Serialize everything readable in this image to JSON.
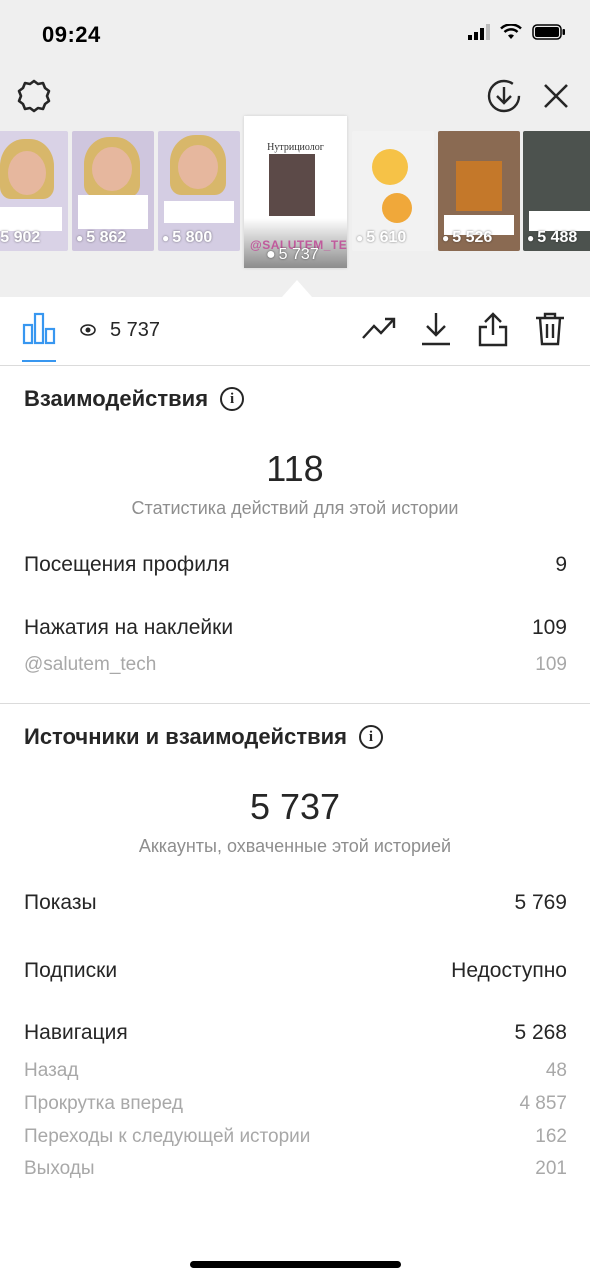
{
  "status_bar": {
    "time": "09:24"
  },
  "stories": [
    {
      "views": "5 902"
    },
    {
      "views": "5 862"
    },
    {
      "views": "5 800"
    },
    {
      "views": "5 610"
    },
    {
      "views": "5 526"
    },
    {
      "views": "5 488"
    }
  ],
  "selected_story": {
    "title": "Нутрициолог",
    "handle": "@SALUTEM_TECH",
    "views": "5 737"
  },
  "toolbar": {
    "views": "5 737"
  },
  "interactions": {
    "title": "Взаимодействия",
    "total": "118",
    "caption": "Статистика действий для этой истории",
    "rows": [
      {
        "label": "Посещения профиля",
        "value": "9"
      },
      {
        "label": "Нажатия на наклейки",
        "value": "109"
      }
    ],
    "sticker_rows": [
      {
        "label": "@salutem_tech",
        "value": "109"
      }
    ]
  },
  "discovery": {
    "title": "Источники и взаимодействия",
    "total": "5 737",
    "caption": "Аккаунты, охваченные этой историей",
    "rows": [
      {
        "label": "Показы",
        "value": "5 769"
      },
      {
        "label": "Подписки",
        "value": "Недоступно"
      },
      {
        "label": "Навигация",
        "value": "5 268"
      }
    ],
    "navigation_rows": [
      {
        "label": "Назад",
        "value": "48"
      },
      {
        "label": "Прокрутка вперед",
        "value": "4 857"
      },
      {
        "label": "Переходы к следующей истории",
        "value": "162"
      },
      {
        "label": "Выходы",
        "value": "201"
      }
    ]
  },
  "colors": {
    "accent": "#3897f0",
    "text": "#262626",
    "secondary": "#8e8e8e"
  }
}
